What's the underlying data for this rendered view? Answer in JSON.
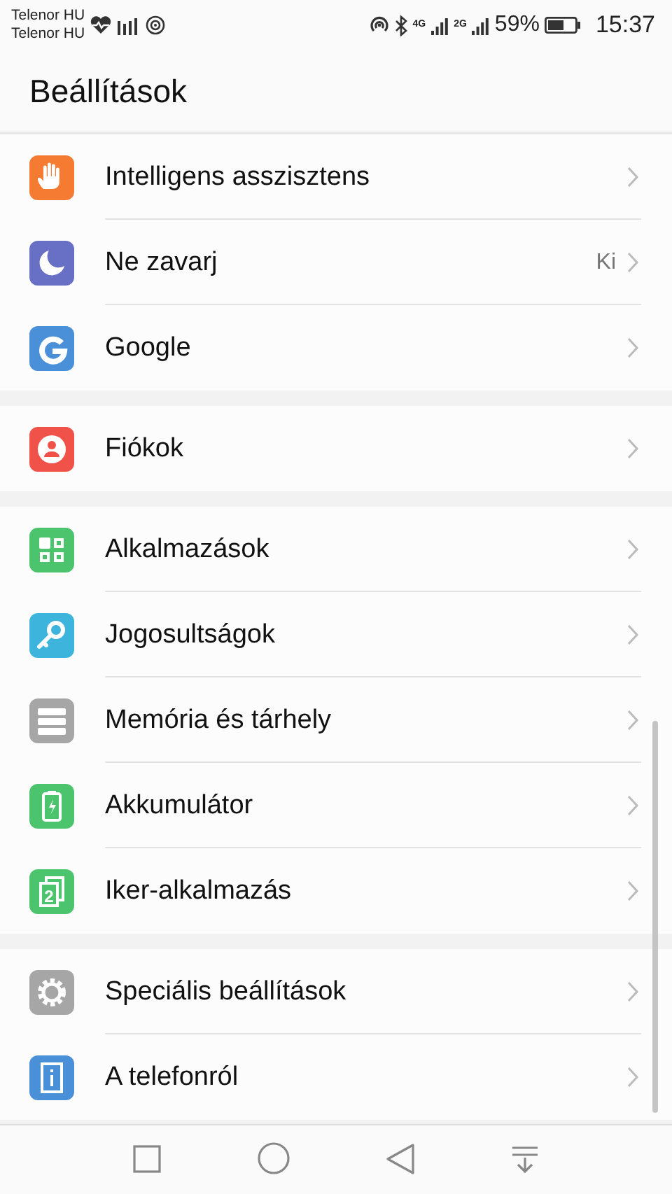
{
  "status_bar": {
    "carriers": [
      "Telenor HU",
      "Telenor HU"
    ],
    "network_1": "4G",
    "network_2": "2G",
    "battery": "59%",
    "time": "15:37"
  },
  "header": {
    "title": "Beállítások"
  },
  "groups": [
    {
      "items": [
        {
          "color": "#f47b31",
          "label": "Intelligens asszisztens"
        },
        {
          "color": "#6770c4",
          "label": "Ne zavarj",
          "value": "Ki"
        },
        {
          "color": "#4a90d9",
          "label": "Google"
        }
      ]
    },
    {
      "items": [
        {
          "color": "#f0524a",
          "label": "Fiókok"
        }
      ]
    },
    {
      "items": [
        {
          "color": "#4cc46e",
          "label": "Alkalmazások"
        },
        {
          "color": "#3db4dc",
          "label": "Jogosultságok"
        },
        {
          "color": "#a6a6a6",
          "label": "Memória és tárhely"
        },
        {
          "color": "#4cc46e",
          "label": "Akkumulátor"
        },
        {
          "color": "#4cc46e",
          "label": "Iker-alkalmazás",
          "icon_label": "2"
        }
      ]
    },
    {
      "items": [
        {
          "color": "#a6a6a6",
          "label": "Speciális beállítások"
        },
        {
          "color": "#4a90d9",
          "label": "A telefonról"
        }
      ]
    }
  ]
}
